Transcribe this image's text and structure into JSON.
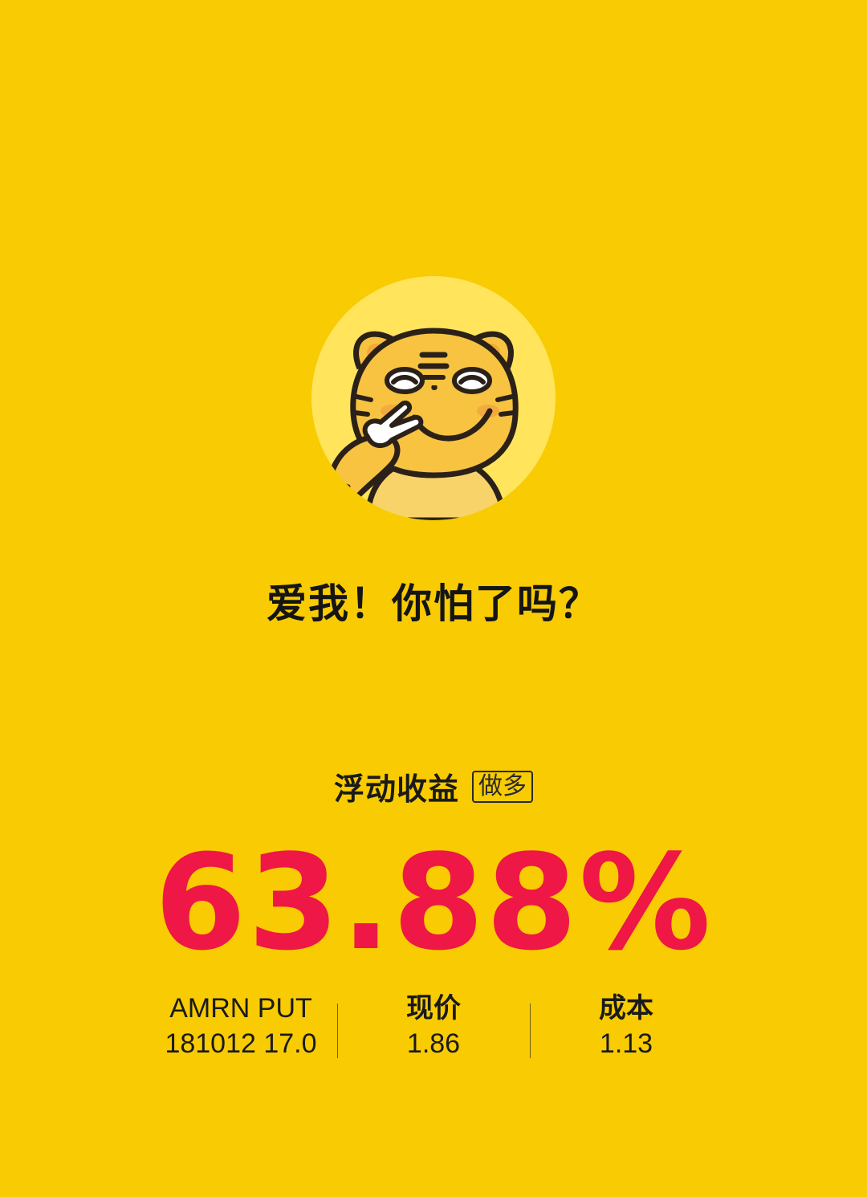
{
  "avatar": {
    "icon": "tiger-peace-sign-icon",
    "colors": {
      "circle": "#FFE45C",
      "tiger": "#F7C341",
      "outline": "#2B2118"
    }
  },
  "slogan": "爱我！你怕了吗？",
  "pnl": {
    "label": "浮动收益",
    "direction_badge": "做多",
    "value": "63.88%",
    "value_color": "#EE1745"
  },
  "stats": {
    "contract": {
      "line1": "AMRN PUT",
      "line2": "181012 17.0"
    },
    "current_price": {
      "label": "现价",
      "value": "1.86"
    },
    "cost": {
      "label": "成本",
      "value": "1.13"
    }
  },
  "colors": {
    "background": "#F8CB02",
    "text": "#1A1A1A"
  }
}
